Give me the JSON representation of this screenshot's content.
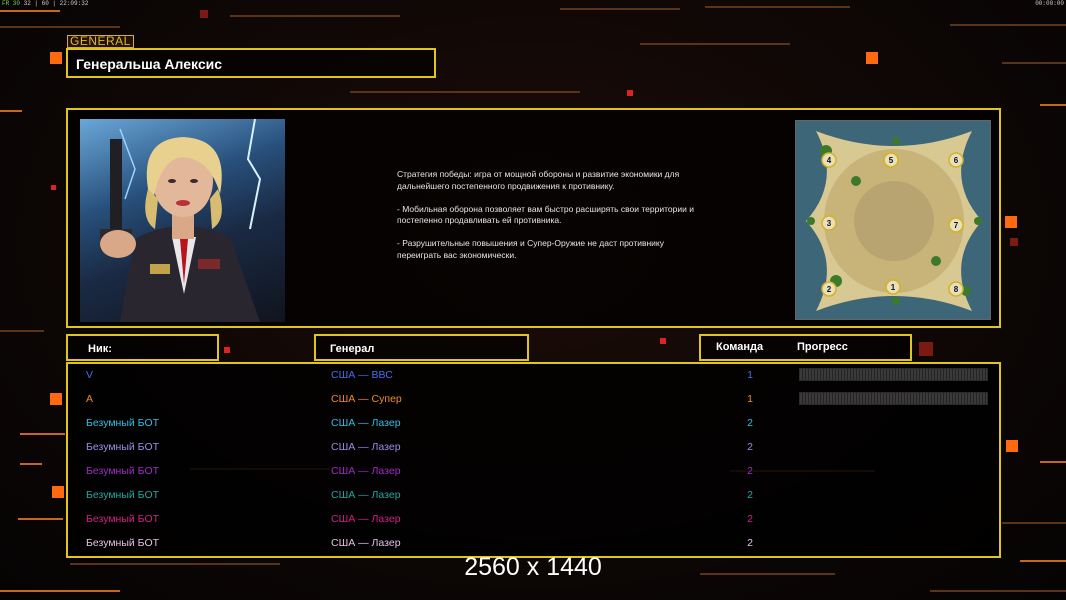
{
  "system_bar": {
    "left_fps": "FR 30",
    "left_rest": "32 | 60 | 22:09:32",
    "right": "00:00:00"
  },
  "general": {
    "tag": "GENERAL",
    "name": "Генеральша Алексис"
  },
  "description": {
    "paragraphs": [
      "Стратегия победы: игра от мощной обороны и развитие экономики для дальнейшего постепенного продвижения к противнику.",
      "- Мобильная оборона позволяет вам быстро расширять свои территории и постепенно продавливать ей противника.",
      "- Разрушительные повышения и Супер-Оружие не даст противнику переиграть вас экономически."
    ]
  },
  "map": {
    "positions": [
      "4",
      "5",
      "6",
      "3",
      "7",
      "2",
      "1",
      "8"
    ]
  },
  "columns": {
    "nick": "Ник:",
    "general": "Генерал",
    "team": "Команда",
    "progress": "Прогресс"
  },
  "players": [
    {
      "nick": "V",
      "general": "США — ВВС",
      "team": "1",
      "color": "#4a6cf0",
      "has_progress": true
    },
    {
      "nick": "A",
      "general": "США — Супер",
      "team": "1",
      "color": "#f08a24",
      "has_progress": true
    },
    {
      "nick": "Безумный БОТ",
      "general": "США — Лазер",
      "team": "2",
      "color": "#2bc0e6",
      "has_progress": false
    },
    {
      "nick": "Безумный БОТ",
      "general": "США — Лазер",
      "team": "2",
      "color": "#a08ae6",
      "has_progress": false
    },
    {
      "nick": "Безумный БОТ",
      "general": "США — Лазер",
      "team": "2",
      "color": "#a02ac8",
      "has_progress": false
    },
    {
      "nick": "Безумный БОТ",
      "general": "США — Лазер",
      "team": "2",
      "color": "#1fa8a0",
      "has_progress": false
    },
    {
      "nick": "Безумный БОТ",
      "general": "США — Лазер",
      "team": "2",
      "color": "#d41e8a",
      "has_progress": false
    },
    {
      "nick": "Безумный БОТ",
      "general": "США — Лазер",
      "team": "2",
      "color": "#e2c0e6",
      "has_progress": false
    }
  ],
  "resolution_label": "2560 x 1440",
  "colors": {
    "frame": "#e0c51c",
    "accent": "#ff6a10"
  }
}
